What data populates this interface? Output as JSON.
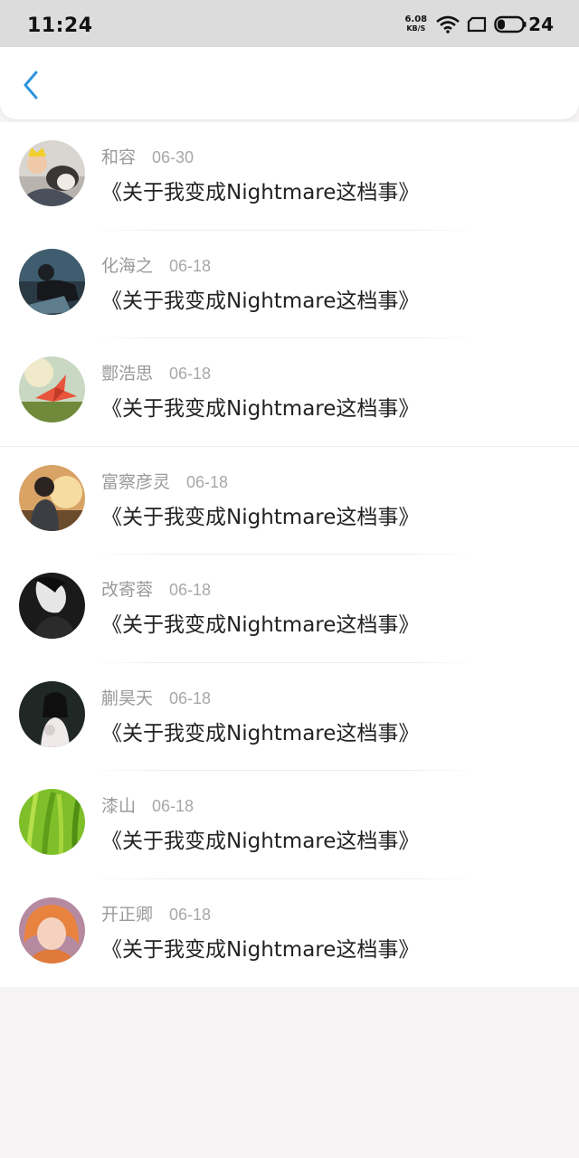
{
  "status_bar": {
    "time": "11:24",
    "net_speed_value": "6.08",
    "net_speed_unit": "KB/S",
    "battery": "24"
  },
  "nav": {
    "back_icon": "chevron-left-icon",
    "accent_color": "#2f95e0"
  },
  "comments": [
    {
      "name": "和容",
      "date": "06-30",
      "text": "《关于我变成Nightmare这档事》"
    },
    {
      "name": "化海之",
      "date": "06-18",
      "text": "《关于我变成Nightmare这档事》"
    },
    {
      "name": "酆浩思",
      "date": "06-18",
      "text": "《关于我变成Nightmare这档事》"
    },
    {
      "name": "富察彦灵",
      "date": "06-18",
      "text": "《关于我变成Nightmare这档事》"
    },
    {
      "name": "改寄蓉",
      "date": "06-18",
      "text": "《关于我变成Nightmare这档事》"
    },
    {
      "name": "蒯昊天",
      "date": "06-18",
      "text": "《关于我变成Nightmare这档事》"
    },
    {
      "name": "漆山",
      "date": "06-18",
      "text": "《关于我变成Nightmare这档事》"
    },
    {
      "name": "开正卿",
      "date": "06-18",
      "text": "《关于我变成Nightmare这档事》"
    }
  ]
}
